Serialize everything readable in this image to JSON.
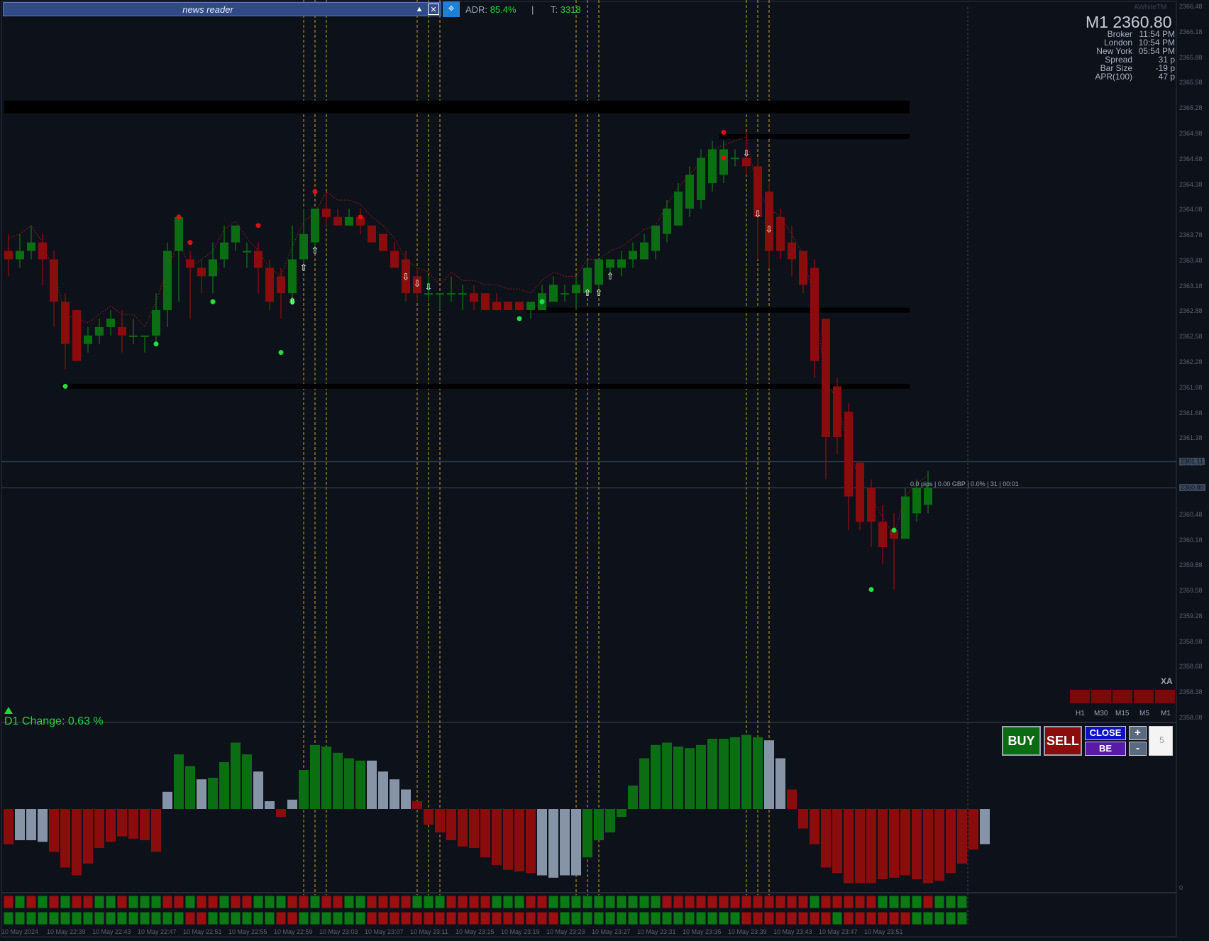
{
  "news_reader": {
    "title": "news reader"
  },
  "stats": {
    "adr_label": "ADR:",
    "adr_value": "85.4%",
    "sep": "|",
    "t_label": "T:",
    "t_value": "3318"
  },
  "info": {
    "brand": "AWhiteTM",
    "headline": "M1 2360.80",
    "rows": [
      {
        "label": "Broker",
        "value": "11:54 PM"
      },
      {
        "label": "London",
        "value": "10:54 PM"
      },
      {
        "label": "New York",
        "value": "05:54 PM"
      },
      {
        "label": "Spread",
        "value": "31 p"
      },
      {
        "label": "Bar Size",
        "value": "-19 p"
      },
      {
        "label": "APR(100)",
        "value": "47 p"
      }
    ]
  },
  "price_axis": [
    "2366.48",
    "2366.18",
    "2365.88",
    "2365.58",
    "2365.28",
    "2364.98",
    "2364.68",
    "2364.38",
    "2364.08",
    "2363.78",
    "2363.48",
    "2363.18",
    "2362.88",
    "2362.58",
    "2362.28",
    "2361.98",
    "2361.68",
    "2361.38",
    "2361.08",
    "2360.78",
    "2360.48",
    "2360.18",
    "2359.88",
    "2359.58",
    "2359.28",
    "2358.98",
    "2358.68",
    "2358.38",
    "2358.08"
  ],
  "current_price_tags": [
    "2361.11",
    "2360.80"
  ],
  "position_info": "0.0 pips | 0.00 GBP | 0.0% | 31 | 00:01",
  "d1_change": "D1 Change: 0.63 %",
  "trade_panel": {
    "buy": "BUY",
    "sell": "SELL",
    "close": "CLOSE",
    "be": "BE",
    "plus": "+",
    "minus": "-",
    "quantity": "5"
  },
  "xa": {
    "label": "XA",
    "timeframes": [
      "H1",
      "M30",
      "M15",
      "M5",
      "M1"
    ],
    "colors": [
      "#7a0a0a",
      "#7a0a0a",
      "#7a0a0a",
      "#7a0a0a",
      "#7a0a0a"
    ]
  },
  "osc_axis": [
    "0"
  ],
  "time_axis": [
    "10 May 2024",
    "10 May 22:39",
    "10 May 22:43",
    "10 May 22:47",
    "10 May 22:51",
    "10 May 22:55",
    "10 May 22:59",
    "10 May 23:03",
    "10 May 23:07",
    "10 May 23:11",
    "10 May 23:15",
    "10 May 23:19",
    "10 May 23:23",
    "10 May 23:27",
    "10 May 23:31",
    "10 May 23:35",
    "10 May 23:39",
    "10 May 23:43",
    "10 May 23:47",
    "10 May 23:51"
  ],
  "colors": {
    "up": "#0b6e12",
    "down": "#8b0c0c",
    "neutral": "#8794a8",
    "accent": "#21d63a"
  },
  "chart_data": {
    "type": "candlestick",
    "ylim": [
      2358.08,
      2366.48
    ],
    "candles": [
      {
        "o": 2363.6,
        "h": 2363.8,
        "l": 2363.3,
        "c": 2363.5
      },
      {
        "o": 2363.5,
        "h": 2363.8,
        "l": 2363.4,
        "c": 2363.6
      },
      {
        "o": 2363.6,
        "h": 2363.9,
        "l": 2363.5,
        "c": 2363.7
      },
      {
        "o": 2363.7,
        "h": 2363.8,
        "l": 2363.2,
        "c": 2363.5
      },
      {
        "o": 2363.5,
        "h": 2363.6,
        "l": 2362.7,
        "c": 2363.0
      },
      {
        "o": 2363.0,
        "h": 2363.1,
        "l": 2362.2,
        "c": 2362.5
      },
      {
        "o": 2362.9,
        "h": 2362.9,
        "l": 2362.3,
        "c": 2362.3
      },
      {
        "o": 2362.5,
        "h": 2362.7,
        "l": 2362.4,
        "c": 2362.6
      },
      {
        "o": 2362.6,
        "h": 2362.8,
        "l": 2362.5,
        "c": 2362.7
      },
      {
        "o": 2362.7,
        "h": 2362.9,
        "l": 2362.6,
        "c": 2362.8
      },
      {
        "o": 2362.7,
        "h": 2362.9,
        "l": 2362.4,
        "c": 2362.6
      },
      {
        "o": 2362.6,
        "h": 2362.8,
        "l": 2362.5,
        "c": 2362.6
      },
      {
        "o": 2362.6,
        "h": 2362.6,
        "l": 2362.4,
        "c": 2362.6
      },
      {
        "o": 2362.6,
        "h": 2363.1,
        "l": 2362.5,
        "c": 2362.9
      },
      {
        "o": 2362.9,
        "h": 2363.7,
        "l": 2362.7,
        "c": 2363.6
      },
      {
        "o": 2363.6,
        "h": 2364.0,
        "l": 2363.0,
        "c": 2364.0
      },
      {
        "o": 2363.5,
        "h": 2363.6,
        "l": 2362.8,
        "c": 2363.4
      },
      {
        "o": 2363.4,
        "h": 2363.5,
        "l": 2363.1,
        "c": 2363.3
      },
      {
        "o": 2363.3,
        "h": 2363.7,
        "l": 2363.1,
        "c": 2363.5
      },
      {
        "o": 2363.5,
        "h": 2363.9,
        "l": 2363.4,
        "c": 2363.7
      },
      {
        "o": 2363.7,
        "h": 2363.9,
        "l": 2363.6,
        "c": 2363.9
      },
      {
        "o": 2363.6,
        "h": 2363.7,
        "l": 2363.4,
        "c": 2363.6
      },
      {
        "o": 2363.6,
        "h": 2363.7,
        "l": 2363.1,
        "c": 2363.4
      },
      {
        "o": 2363.4,
        "h": 2363.5,
        "l": 2362.9,
        "c": 2363.0
      },
      {
        "o": 2363.3,
        "h": 2363.4,
        "l": 2362.8,
        "c": 2363.1
      },
      {
        "o": 2363.1,
        "h": 2363.9,
        "l": 2363.0,
        "c": 2363.5
      },
      {
        "o": 2363.5,
        "h": 2364.1,
        "l": 2363.4,
        "c": 2363.8
      },
      {
        "o": 2363.7,
        "h": 2364.1,
        "l": 2363.6,
        "c": 2364.1
      },
      {
        "o": 2364.1,
        "h": 2364.3,
        "l": 2363.9,
        "c": 2364.0
      },
      {
        "o": 2364.0,
        "h": 2364.1,
        "l": 2363.9,
        "c": 2363.9
      },
      {
        "o": 2363.9,
        "h": 2364.1,
        "l": 2363.9,
        "c": 2364.0
      },
      {
        "o": 2364.0,
        "h": 2364.1,
        "l": 2363.8,
        "c": 2363.9
      },
      {
        "o": 2363.9,
        "h": 2363.9,
        "l": 2363.7,
        "c": 2363.7
      },
      {
        "o": 2363.8,
        "h": 2363.8,
        "l": 2363.6,
        "c": 2363.6
      },
      {
        "o": 2363.6,
        "h": 2363.7,
        "l": 2363.4,
        "c": 2363.4
      },
      {
        "o": 2363.5,
        "h": 2363.6,
        "l": 2363.0,
        "c": 2363.1
      },
      {
        "o": 2363.3,
        "h": 2363.4,
        "l": 2363.0,
        "c": 2363.1
      },
      {
        "o": 2363.1,
        "h": 2363.3,
        "l": 2363.0,
        "c": 2363.1
      },
      {
        "o": 2363.1,
        "h": 2363.1,
        "l": 2362.9,
        "c": 2363.1
      },
      {
        "o": 2363.1,
        "h": 2363.3,
        "l": 2363.0,
        "c": 2363.1
      },
      {
        "o": 2363.1,
        "h": 2363.2,
        "l": 2362.9,
        "c": 2363.1
      },
      {
        "o": 2363.1,
        "h": 2363.2,
        "l": 2362.9,
        "c": 2363.0
      },
      {
        "o": 2363.1,
        "h": 2363.1,
        "l": 2362.9,
        "c": 2362.9
      },
      {
        "o": 2363.0,
        "h": 2363.1,
        "l": 2362.9,
        "c": 2362.9
      },
      {
        "o": 2363.0,
        "h": 2363.0,
        "l": 2362.9,
        "c": 2362.9
      },
      {
        "o": 2363.0,
        "h": 2363.0,
        "l": 2362.9,
        "c": 2362.9
      },
      {
        "o": 2362.9,
        "h": 2363.0,
        "l": 2362.8,
        "c": 2363.0
      },
      {
        "o": 2362.9,
        "h": 2363.2,
        "l": 2362.9,
        "c": 2363.1
      },
      {
        "o": 2363.0,
        "h": 2363.3,
        "l": 2363.0,
        "c": 2363.2
      },
      {
        "o": 2363.1,
        "h": 2363.2,
        "l": 2363.0,
        "c": 2363.1
      },
      {
        "o": 2363.1,
        "h": 2363.3,
        "l": 2362.9,
        "c": 2363.2
      },
      {
        "o": 2363.1,
        "h": 2363.5,
        "l": 2363.1,
        "c": 2363.4
      },
      {
        "o": 2363.2,
        "h": 2363.5,
        "l": 2363.1,
        "c": 2363.5
      },
      {
        "o": 2363.4,
        "h": 2363.5,
        "l": 2363.3,
        "c": 2363.5
      },
      {
        "o": 2363.4,
        "h": 2363.6,
        "l": 2363.3,
        "c": 2363.5
      },
      {
        "o": 2363.5,
        "h": 2363.7,
        "l": 2363.4,
        "c": 2363.6
      },
      {
        "o": 2363.5,
        "h": 2363.8,
        "l": 2363.5,
        "c": 2363.7
      },
      {
        "o": 2363.6,
        "h": 2363.9,
        "l": 2363.5,
        "c": 2363.9
      },
      {
        "o": 2363.8,
        "h": 2364.2,
        "l": 2363.7,
        "c": 2364.1
      },
      {
        "o": 2363.9,
        "h": 2364.4,
        "l": 2363.9,
        "c": 2364.3
      },
      {
        "o": 2364.1,
        "h": 2364.6,
        "l": 2364.0,
        "c": 2364.5
      },
      {
        "o": 2364.2,
        "h": 2364.8,
        "l": 2364.1,
        "c": 2364.7
      },
      {
        "o": 2364.4,
        "h": 2364.9,
        "l": 2364.3,
        "c": 2364.8
      },
      {
        "o": 2364.5,
        "h": 2364.9,
        "l": 2364.4,
        "c": 2364.8
      },
      {
        "o": 2364.7,
        "h": 2364.8,
        "l": 2364.6,
        "c": 2364.7
      },
      {
        "o": 2364.7,
        "h": 2365.0,
        "l": 2364.5,
        "c": 2364.6
      },
      {
        "o": 2364.6,
        "h": 2364.7,
        "l": 2363.5,
        "c": 2364.0
      },
      {
        "o": 2364.3,
        "h": 2364.4,
        "l": 2363.4,
        "c": 2363.6
      },
      {
        "o": 2364.0,
        "h": 2364.1,
        "l": 2363.5,
        "c": 2363.6
      },
      {
        "o": 2363.7,
        "h": 2363.9,
        "l": 2363.3,
        "c": 2363.5
      },
      {
        "o": 2363.6,
        "h": 2363.6,
        "l": 2363.1,
        "c": 2363.2
      },
      {
        "o": 2363.4,
        "h": 2363.5,
        "l": 2362.1,
        "c": 2362.3
      },
      {
        "o": 2362.8,
        "h": 2362.8,
        "l": 2360.9,
        "c": 2361.4
      },
      {
        "o": 2362.0,
        "h": 2362.1,
        "l": 2361.2,
        "c": 2361.4
      },
      {
        "o": 2361.7,
        "h": 2361.8,
        "l": 2360.3,
        "c": 2360.7
      },
      {
        "o": 2361.1,
        "h": 2361.1,
        "l": 2360.3,
        "c": 2360.4
      },
      {
        "o": 2360.8,
        "h": 2360.9,
        "l": 2360.1,
        "c": 2360.4
      },
      {
        "o": 2360.4,
        "h": 2360.6,
        "l": 2359.9,
        "c": 2360.1
      },
      {
        "o": 2360.3,
        "h": 2360.5,
        "l": 2359.6,
        "c": 2360.2
      },
      {
        "o": 2360.2,
        "h": 2360.8,
        "l": 2360.2,
        "c": 2360.7
      },
      {
        "o": 2360.5,
        "h": 2360.9,
        "l": 2360.4,
        "c": 2360.8
      },
      {
        "o": 2360.6,
        "h": 2361.0,
        "l": 2360.5,
        "c": 2360.8
      }
    ],
    "histogram": [
      -45,
      -40,
      -40,
      -42,
      -55,
      -75,
      -85,
      -70,
      -50,
      -42,
      -35,
      -38,
      -40,
      -55,
      22,
      70,
      55,
      38,
      40,
      60,
      85,
      70,
      48,
      10,
      -10,
      12,
      50,
      82,
      80,
      72,
      65,
      62,
      62,
      48,
      38,
      25,
      10,
      -20,
      -30,
      -40,
      -48,
      -50,
      -62,
      -72,
      -78,
      -80,
      -82,
      -85,
      -88,
      -85,
      -85,
      -62,
      -40,
      -30,
      -10,
      30,
      65,
      82,
      85,
      80,
      78,
      82,
      90,
      90,
      92,
      95,
      92,
      88,
      65,
      25,
      -25,
      -45,
      -75,
      -82,
      -95,
      -95,
      -95,
      -90,
      -88,
      -85,
      -90,
      -95,
      -92,
      -82,
      -70,
      -52,
      -45
    ],
    "histogram_colors": [
      "d",
      "n",
      "n",
      "n",
      "d",
      "d",
      "d",
      "d",
      "d",
      "d",
      "d",
      "d",
      "d",
      "d",
      "n",
      "u",
      "u",
      "n",
      "u",
      "u",
      "u",
      "u",
      "n",
      "n",
      "d",
      "n",
      "u",
      "u",
      "u",
      "u",
      "u",
      "u",
      "n",
      "n",
      "n",
      "n",
      "d",
      "d",
      "d",
      "d",
      "d",
      "d",
      "d",
      "d",
      "d",
      "d",
      "d",
      "n",
      "n",
      "n",
      "n",
      "u",
      "u",
      "u",
      "u",
      "u",
      "u",
      "u",
      "u",
      "u",
      "u",
      "u",
      "u",
      "u",
      "u",
      "u",
      "u",
      "n",
      "n",
      "d",
      "d",
      "d",
      "d",
      "d",
      "d",
      "d",
      "d",
      "d",
      "d",
      "d",
      "d",
      "d",
      "d",
      "d",
      "d",
      "d",
      "n"
    ],
    "strip1": "dudududduuduuudduddudduuuddudduudddduuudddduuudduuuuuuuuuuddddddddddddduddddduuuuduuu",
    "strip2": "uuuuuuuuuuuuuuuudduuuuuudduuuuuuddddddddddddddddduuuuuuuuuuuuuuuuddddddddudddddduuuuu",
    "signals_up": [
      25,
      26,
      27,
      51,
      52,
      53
    ],
    "signals_down": [
      35,
      36,
      37,
      65,
      66,
      67
    ],
    "swing_highs": [
      {
        "i": 15,
        "p": 2364.0
      },
      {
        "i": 16,
        "p": 2363.7
      },
      {
        "i": 22,
        "p": 2363.9
      },
      {
        "i": 27,
        "p": 2364.3
      },
      {
        "i": 31,
        "p": 2364.0
      },
      {
        "i": 63,
        "p": 2365.0
      },
      {
        "i": 63,
        "p": 2364.7
      }
    ],
    "swing_lows": [
      {
        "i": 5,
        "p": 2362.0
      },
      {
        "i": 13,
        "p": 2362.5
      },
      {
        "i": 18,
        "p": 2363.0
      },
      {
        "i": 24,
        "p": 2362.4
      },
      {
        "i": 25,
        "p": 2363.0
      },
      {
        "i": 45,
        "p": 2362.8
      },
      {
        "i": 47,
        "p": 2363.0
      },
      {
        "i": 76,
        "p": 2359.6
      },
      {
        "i": 78,
        "p": 2360.3
      }
    ],
    "levels": [
      {
        "p": 2365.3,
        "from": 0,
        "to": 79
      },
      {
        "p": 2364.95,
        "from": 63,
        "to": 79
      },
      {
        "p": 2362.9,
        "from": 46,
        "to": 79
      },
      {
        "p": 2362.0,
        "from": 5,
        "to": 79
      }
    ],
    "current_prices": [
      2361.11,
      2360.8
    ]
  }
}
